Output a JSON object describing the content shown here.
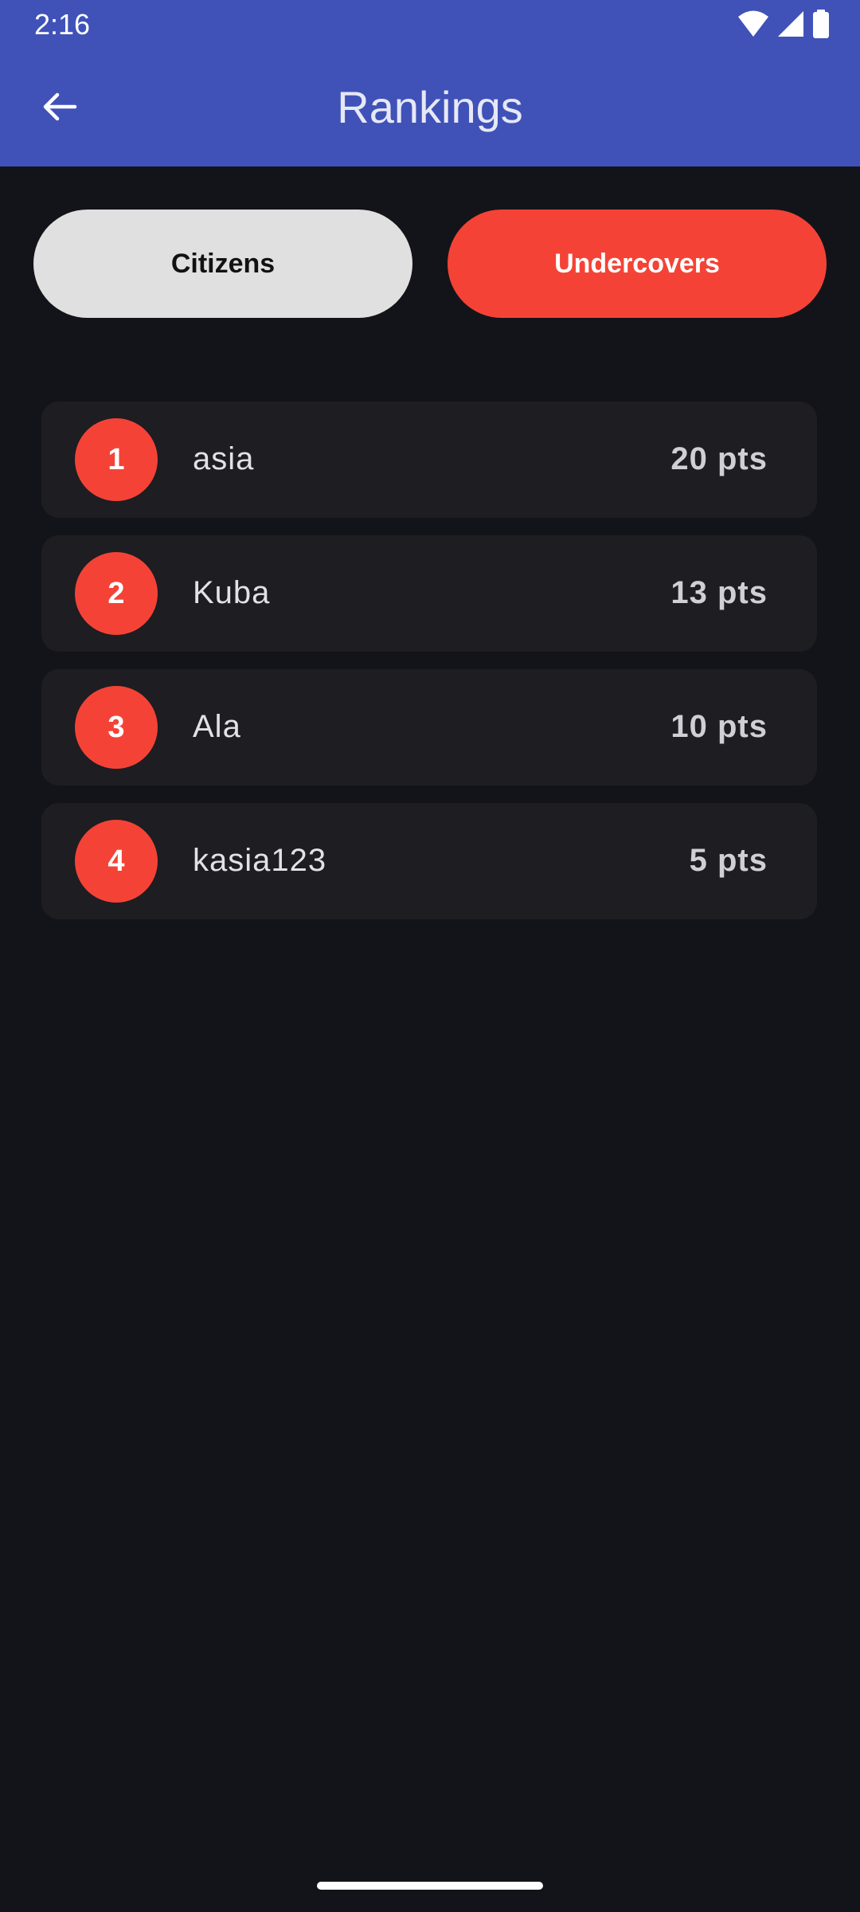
{
  "status_bar": {
    "time": "2:16",
    "icons": [
      "wifi-icon",
      "cellular-signal-icon",
      "battery-icon"
    ]
  },
  "app_bar": {
    "title": "Rankings",
    "back_icon": "arrow-back-icon"
  },
  "tabs": [
    {
      "label": "Citizens",
      "selected": false
    },
    {
      "label": "Undercovers",
      "selected": true
    }
  ],
  "rankings": [
    {
      "rank": "1",
      "name": "asia",
      "points": "20 pts"
    },
    {
      "rank": "2",
      "name": "Kuba",
      "points": "13 pts"
    },
    {
      "rank": "3",
      "name": "Ala",
      "points": "10 pts"
    },
    {
      "rank": "4",
      "name": "kasia123",
      "points": "5 pts"
    }
  ],
  "colors": {
    "app_bar": "#4052b8",
    "background": "#131419",
    "accent": "#f44336",
    "card": "#1d1d22",
    "tab_inactive": "#e0e0e0"
  }
}
